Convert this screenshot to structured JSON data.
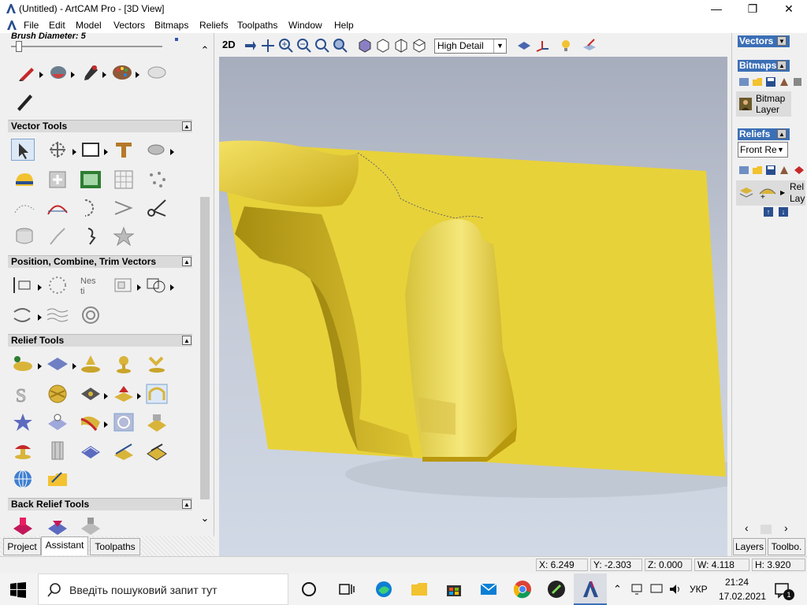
{
  "window": {
    "title": "(Untitled) - ArtCAM Pro - [3D View]",
    "minimize_glyph": "—",
    "maximize_glyph": "❐",
    "close_glyph": "✕"
  },
  "menu": [
    "File",
    "Edit",
    "Model",
    "Vectors",
    "Bitmaps",
    "Reliefs",
    "Toolpaths",
    "Window",
    "Help"
  ],
  "left_panel": {
    "brush_label": "Brush Diameter:",
    "brush_value": "5",
    "sections": [
      {
        "title": "Vector Tools"
      },
      {
        "title": "Position, Combine, Trim Vectors"
      },
      {
        "title": "Relief Tools"
      },
      {
        "title": "Back Relief Tools"
      }
    ],
    "bottom_tabs": [
      "Project",
      "Assistant",
      "Toolpaths"
    ]
  },
  "toolbar": {
    "view_2d_label": "2D",
    "detail_value": "High Detail"
  },
  "right_panel": {
    "vectors_header": "Vectors",
    "bitmaps_header": "Bitmaps",
    "bitmap_layer_line1": "Bitmap",
    "bitmap_layer_line2": "Layer",
    "reliefs_header": "Reliefs",
    "relief_select": "Front Re",
    "relief_layer_line1": "Rel",
    "relief_layer_line2": "Lay",
    "bottom_tabs": [
      "Layers",
      "Toolbo."
    ]
  },
  "status": {
    "x": "X: 6.249",
    "y": "Y: -2.303",
    "z": "Z: 0.000",
    "w": "W: 4.118",
    "h": "H: 3.920"
  },
  "taskbar": {
    "search_placeholder": "Введіть пошуковий запит тут",
    "lang": "УКР",
    "time": "21:24",
    "date": "17.02.2021",
    "notification_count": "1"
  },
  "colors": {
    "relief": "#e8d23a",
    "accent": "#3b6fb6",
    "viewport_top": "#a6adbd",
    "viewport_bottom": "#d1d9e6"
  }
}
